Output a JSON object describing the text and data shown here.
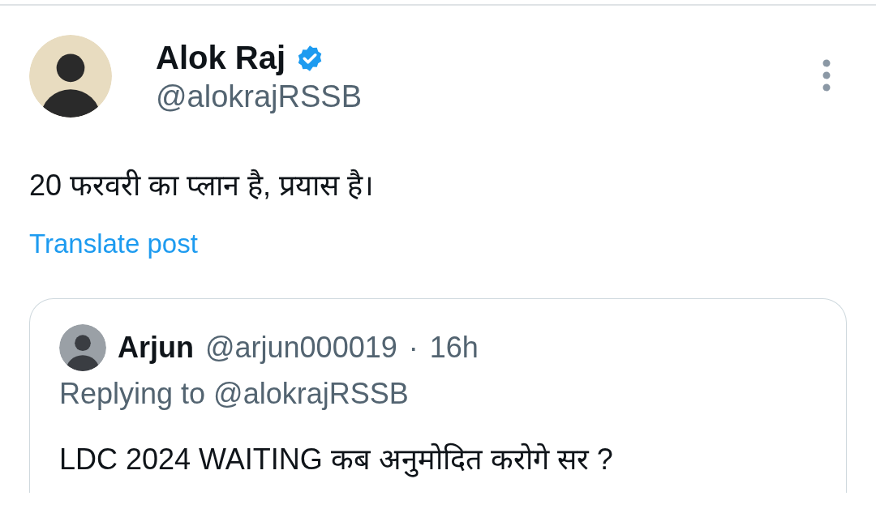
{
  "author": {
    "name": "Alok Raj",
    "verified": true,
    "handle": "@alokrajRSSB"
  },
  "text": "20 फरवरी का प्लान है, प्रयास है।",
  "translate_link": "Translate post",
  "quoted_post": {
    "name": "Arjun",
    "handle": "@arjun000019",
    "separator": "·",
    "time": "16h",
    "replying_to": "Replying to @alokrajRSSB",
    "text": "LDC 2024 WAITING कब अनुमोदित करोगे सर ?"
  }
}
